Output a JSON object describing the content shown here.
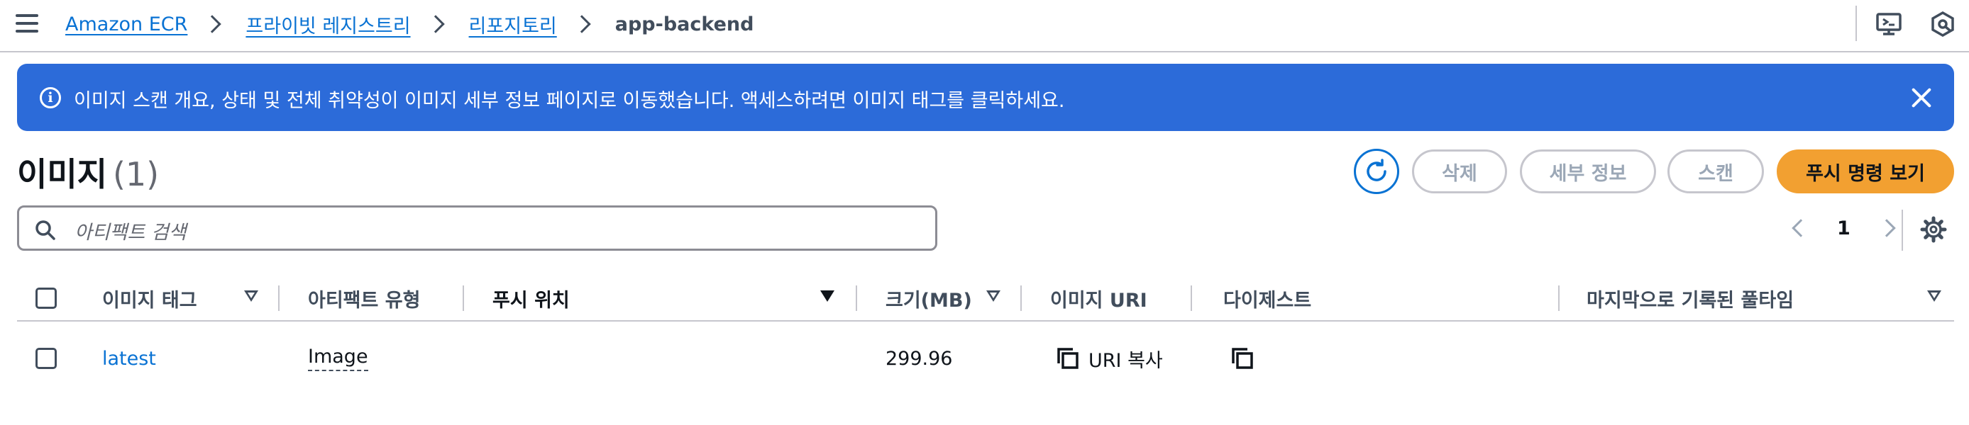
{
  "breadcrumb": {
    "items": [
      "Amazon ECR",
      "프라이빗 레지스트리",
      "리포지토리"
    ],
    "current": "app-backend"
  },
  "topbar": {
    "icons": [
      "screen-share-icon",
      "settings-hex-icon"
    ]
  },
  "flash": {
    "type": "info",
    "message": "이미지 스캔 개요, 상태 및 전체 취약성이 이미지 세부 정보 페이지로 이동했습니다. 액세스하려면 이미지 태그를 클릭하세요."
  },
  "header": {
    "title": "이미지",
    "count": "(1)"
  },
  "actions": {
    "delete": "삭제",
    "details": "세부 정보",
    "scan": "스캔",
    "push_commands": "푸시 명령 보기"
  },
  "search": {
    "placeholder": "아티팩트 검색"
  },
  "pagination": {
    "current_page": "1"
  },
  "table": {
    "columns": [
      "이미지 태그",
      "아티팩트 유형",
      "푸시 위치",
      "크기(MB)",
      "이미지 URI",
      "다이제스트",
      "마지막으로 기록된 풀타임"
    ],
    "rows": [
      {
        "tag": "latest",
        "artifact_type": "Image",
        "pushed_at": "",
        "size": "299.96",
        "uri_copy": "URI 복사",
        "digest": "",
        "last_pulled": ""
      }
    ]
  },
  "colors": {
    "link": "#0972d3",
    "flash_bg": "#2c6bd9",
    "primary_button": "#f2a031",
    "border": "#c6c6cd"
  }
}
